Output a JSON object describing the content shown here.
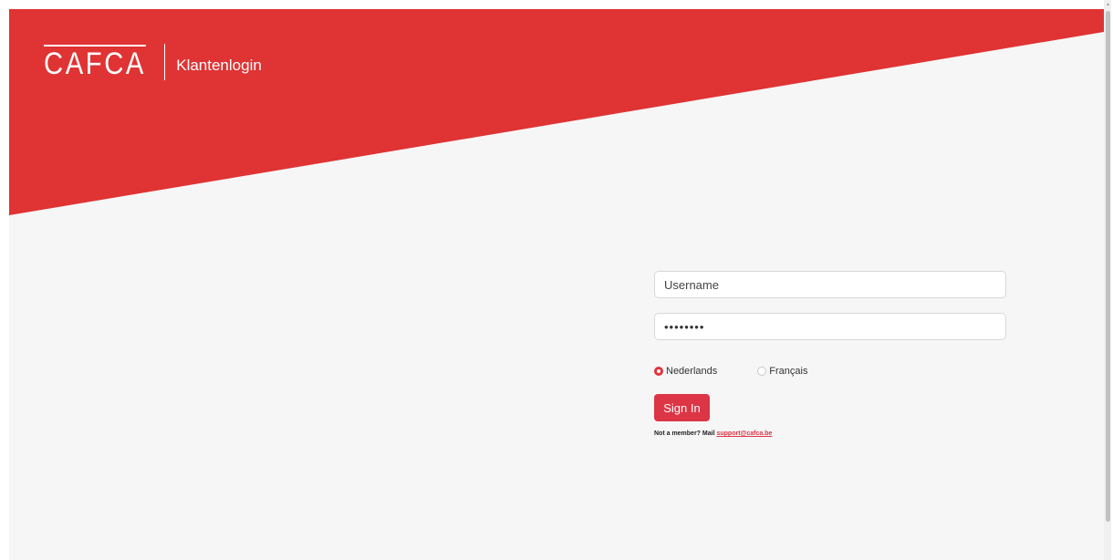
{
  "brand": {
    "logo_text": "CAFCA",
    "subtitle": "Klantenlogin",
    "accent_color": "#e03333",
    "button_color": "#dc3545",
    "background_color": "#f6f6f6"
  },
  "login": {
    "username_placeholder": "Username",
    "username_value": "",
    "password_value": "passwd12"
  },
  "languages": {
    "selected": "Nederlands",
    "options": [
      {
        "label": "Nederlands",
        "checked": true
      },
      {
        "label": "Français",
        "checked": false
      }
    ]
  },
  "actions": {
    "signin_label": "Sign In"
  },
  "footer": {
    "member_text": "Not a member? Mail ",
    "support_email": "support@cafca.be"
  },
  "icons": {
    "scroll_up": "chevron-up-icon"
  }
}
